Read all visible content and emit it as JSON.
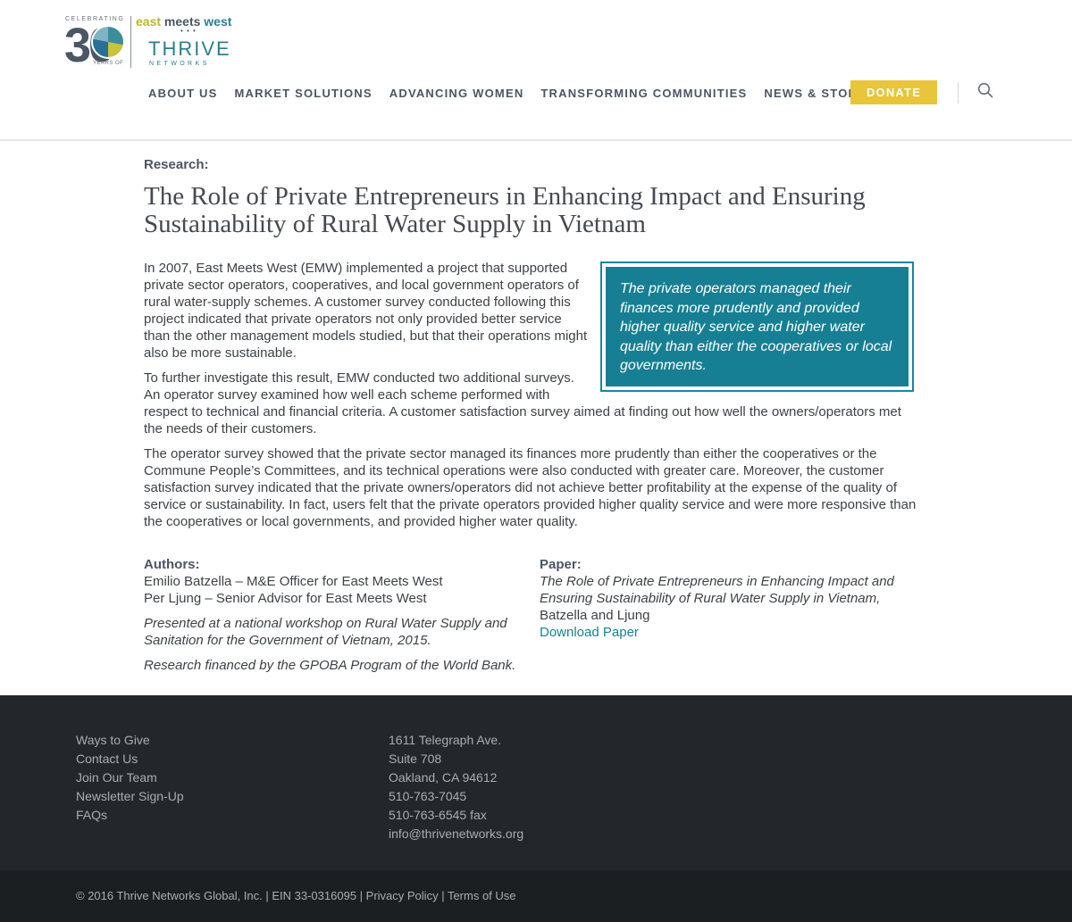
{
  "logo": {
    "celebrating": "CELEBRATING",
    "number": "30",
    "years_of": "YEARS OF",
    "east": "east",
    "meets": "meets",
    "west": "west",
    "dots": "• • •",
    "thrive": "THRIVE",
    "networks": "NETWORKS"
  },
  "nav": {
    "items": [
      "ABOUT US",
      "MARKET SOLUTIONS",
      "ADVANCING WOMEN",
      "TRANSFORMING COMMUNITIES",
      "NEWS & STORIES"
    ],
    "donate": "DONATE"
  },
  "article": {
    "kicker": "Research:",
    "title": "The Role of Private Entrepreneurs in Enhancing Impact and Ensuring Sustainability of Rural Water Supply in Vietnam",
    "pullquote": "The private operators managed their finances more prudently and provided higher quality service and higher water quality than either the cooperatives or local governments.",
    "paragraphs": [
      "In 2007, East Meets West (EMW) implemented a project that supported private sector operators, cooperatives, and local government operators of rural water-supply schemes. A customer survey conducted following this project indicated that private operators not only provided better service than the other management models studied, but that their operations might also be more sustainable.",
      "To further investigate this result, EMW conducted two additional surveys. An operator survey examined how well each scheme performed with respect to technical and financial criteria. A customer satisfaction survey aimed at finding out how well the owners/operators met the needs of their customers.",
      "The operator survey showed that the private sector managed its finances more prudently than either the cooperatives or the Commune People’s Committees, and its technical operations were also conducted with greater care. Moreover, the customer satisfaction survey indicated that the private owners/operators did not achieve better profitability at the expense of the quality of service or sustainability. In fact, users felt that the private operators provided higher quality service and were more responsive than the cooperatives or local governments, and provided higher water quality."
    ],
    "authors_label": "Authors:",
    "authors": [
      "Emilio Batzella – M&E Officer for East Meets West",
      "Per Ljung – Senior Advisor for East Meets West"
    ],
    "presented": "Presented at a national workshop on Rural Water Supply and Sanitation for the Government of Vietnam, 2015.",
    "financed": "Research financed by the GPOBA Program of the World Bank.",
    "paper_label": "Paper:",
    "paper_title": "The Role of Private Entrepreneurs in Enhancing Impact and Ensuring Sustainability of Rural Water Supply in Vietnam,",
    "paper_authors": " Batzella and Ljung",
    "download": "Download Paper"
  },
  "footer": {
    "links": [
      "Ways to Give",
      "Contact Us",
      "Join Our Team",
      "Newsletter Sign-Up",
      "FAQs"
    ],
    "address": [
      "1611 Telegraph Ave.",
      "Suite 708",
      "Oakland, CA 94612",
      "510-763-7045",
      "510-763-6545 fax",
      "info@thrivenetworks.org"
    ],
    "copyright": "© 2016 Thrive Networks Global, Inc. | EIN 33-0316095 | ",
    "privacy": "Privacy Policy",
    "sep": " | ",
    "terms": "Terms of Use"
  },
  "colors": {
    "accent_teal": "#177f93",
    "donate_yellow": "#e8c53a",
    "footer_bg": "#23272b"
  },
  "icons": {
    "search": "search-icon"
  }
}
